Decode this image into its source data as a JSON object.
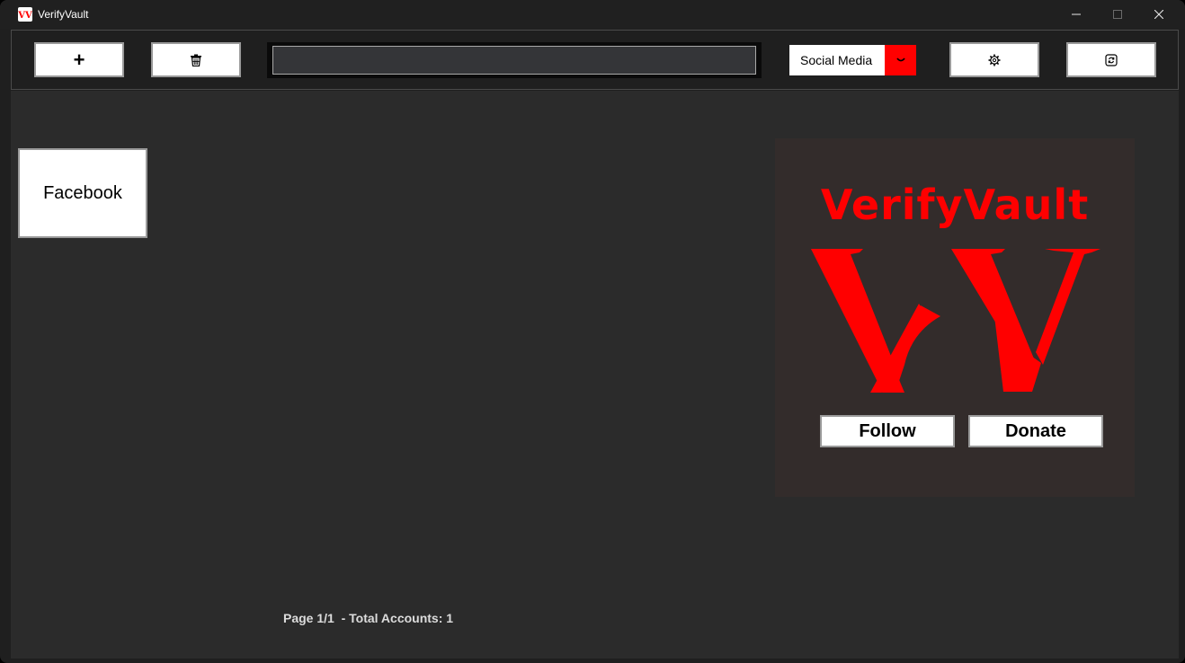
{
  "window": {
    "title": "VerifyVault",
    "app_icon_text": "VV"
  },
  "toolbar": {
    "add_icon": "plus-icon",
    "add_label": "+",
    "delete_icon": "trash-icon",
    "search": {
      "value": "",
      "placeholder": ""
    },
    "category": {
      "selected": "Social Media",
      "arrow_icon": "chevron-down-icon"
    },
    "settings_icon": "gear-icon",
    "refresh_icon": "refresh-icon"
  },
  "accounts": [
    {
      "label": "Facebook"
    }
  ],
  "promo": {
    "wordmark": "VerifyVault",
    "logo_icon": "vv-logo",
    "follow_label": "Follow",
    "donate_label": "Donate"
  },
  "status": {
    "text": "Page 1/1  - Total Accounts: 1"
  },
  "colors": {
    "accent": "#ff0000",
    "background": "#2b2b2b",
    "toolbar_bg": "#1f1f1f",
    "promo_bg": "#332c2b",
    "button_bg": "#ffffff"
  }
}
